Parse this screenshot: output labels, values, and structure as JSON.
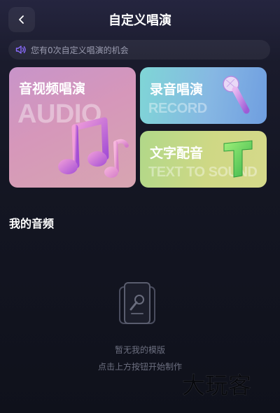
{
  "header": {
    "title": "自定义唱演",
    "back_icon": "chevron-left-icon"
  },
  "notice": {
    "icon": "speaker-icon",
    "text": "您有0次自定义唱演的机会"
  },
  "cards": {
    "audio": {
      "title": "音视频唱演",
      "watermark": "AUDIO",
      "icon": "music-note-icon"
    },
    "record": {
      "title": "录音唱演",
      "watermark": "RECORD",
      "icon": "microphone-icon"
    },
    "tts": {
      "title": "文字配音",
      "watermark": "TEXT TO SOUND",
      "icon": "letter-t-icon"
    }
  },
  "my_audio": {
    "section_title": "我的音频",
    "empty_icon": "karaoke-card-icon",
    "empty_line1": "暂无我的模版",
    "empty_line2": "点击上方按钮开始制作"
  },
  "site_watermark": {
    "text": "大玩客"
  },
  "colors": {
    "background": "#141623",
    "accent_purple": "#8b6cff",
    "muted_text": "#6c6f80"
  }
}
